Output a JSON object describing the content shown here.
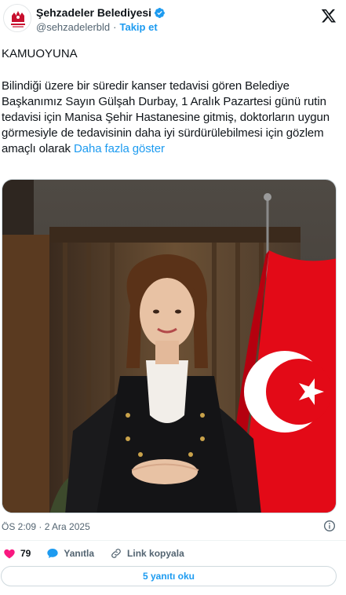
{
  "account": {
    "name": "Şehzadeler Belediyesi",
    "handle": "@sehzadelerbld",
    "separator": "·",
    "follow_label": "Takip et",
    "verified_color": "#1d9bf0",
    "logo_icon": "municipality-logo",
    "logo_color": "#c8102e"
  },
  "post": {
    "heading": "KAMUOYUNA",
    "body": "Bilindiği üzere bir süredir kanser tedavisi gören Belediye Başkanımız Sayın Gülşah Durbay, 1 Aralık Pazartesi günü rutin tedavisi için Manisa Şehir Hastanesine gitmiş, doktorların uygun görmesiyle de tedavisinin daha iyi sürdürülebilmesi için gözlem amaçlı olarak",
    "show_more": "Daha fazla göster",
    "photo_icon": "portrait-photo",
    "timestamp": "ÖS 2:09 · 2 Ara 2025"
  },
  "actions": {
    "like_count": "79",
    "reply_label": "Yanıtla",
    "copy_link_label": "Link kopyala",
    "read_replies_label": "5 yanıtı oku"
  },
  "colors": {
    "accent": "#1d9bf0",
    "like": "#f91880",
    "flag": "#e30a17"
  }
}
